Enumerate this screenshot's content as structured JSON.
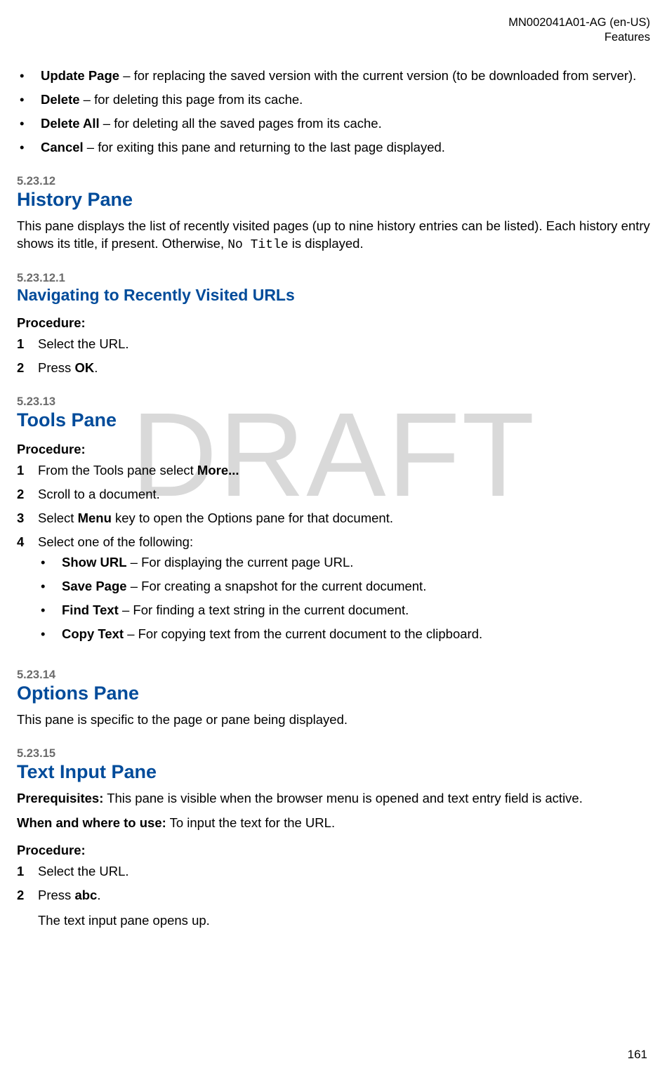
{
  "watermark": "DRAFT",
  "header": {
    "doc_id": "MN002041A01-AG (en-US)",
    "section": "Features"
  },
  "footer": {
    "page": "161"
  },
  "labels": {
    "procedure": "Procedure:",
    "prerequisites": "Prerequisites:",
    "when_where": "When and where to use:"
  },
  "top_bullets": [
    {
      "term": "Update Page",
      "desc": " – for replacing the saved version with the current version (to be downloaded from server)."
    },
    {
      "term": "Delete",
      "desc": " – for deleting this page from its cache."
    },
    {
      "term": "Delete All",
      "desc": " – for deleting all the saved pages from its cache."
    },
    {
      "term": "Cancel",
      "desc": " – for exiting this pane and returning to the last page displayed."
    }
  ],
  "sections": [
    {
      "number": "5.23.12",
      "title": "History Pane",
      "body_pre": "This pane displays the list of recently visited pages (up to nine history entries can be listed). Each history entry shows its title, if present. Otherwise, ",
      "body_code": "No Title",
      "body_post": " is displayed."
    },
    {
      "number": "5.23.12.1",
      "title": "Navigating to Recently Visited URLs",
      "steps": [
        {
          "n": "1",
          "text": "Select the URL."
        },
        {
          "n": "2",
          "pre": "Press ",
          "bold": "OK",
          "post": "."
        }
      ]
    },
    {
      "number": "5.23.13",
      "title": "Tools Pane",
      "steps": [
        {
          "n": "1",
          "pre": "From the Tools pane select ",
          "bold": "More..."
        },
        {
          "n": "2",
          "text": "Scroll to a document."
        },
        {
          "n": "3",
          "pre": "Select ",
          "bold": "Menu",
          "post": " key to open the Options pane for that document."
        },
        {
          "n": "4",
          "text": "Select one of the following:"
        }
      ],
      "sub": [
        {
          "term": "Show URL",
          "desc": " – For displaying the current page URL."
        },
        {
          "term": "Save Page",
          "desc": " – For creating a snapshot for the current document."
        },
        {
          "term": "Find Text",
          "desc": " – For finding a text string in the current document."
        },
        {
          "term": "Copy Text",
          "desc": " – For copying text from the current document to the clipboard."
        }
      ]
    },
    {
      "number": "5.23.14",
      "title": "Options Pane",
      "body": "This pane is specific to the page or pane being displayed."
    },
    {
      "number": "5.23.15",
      "title": "Text Input Pane",
      "prereq": "This pane is visible when the browser menu is opened and text entry field is active.",
      "when": "To input the text for the URL.",
      "steps": [
        {
          "n": "1",
          "text": "Select the URL."
        },
        {
          "n": "2",
          "pre": "Press ",
          "bold": "abc",
          "post": "."
        }
      ],
      "result": "The text input pane opens up."
    }
  ]
}
